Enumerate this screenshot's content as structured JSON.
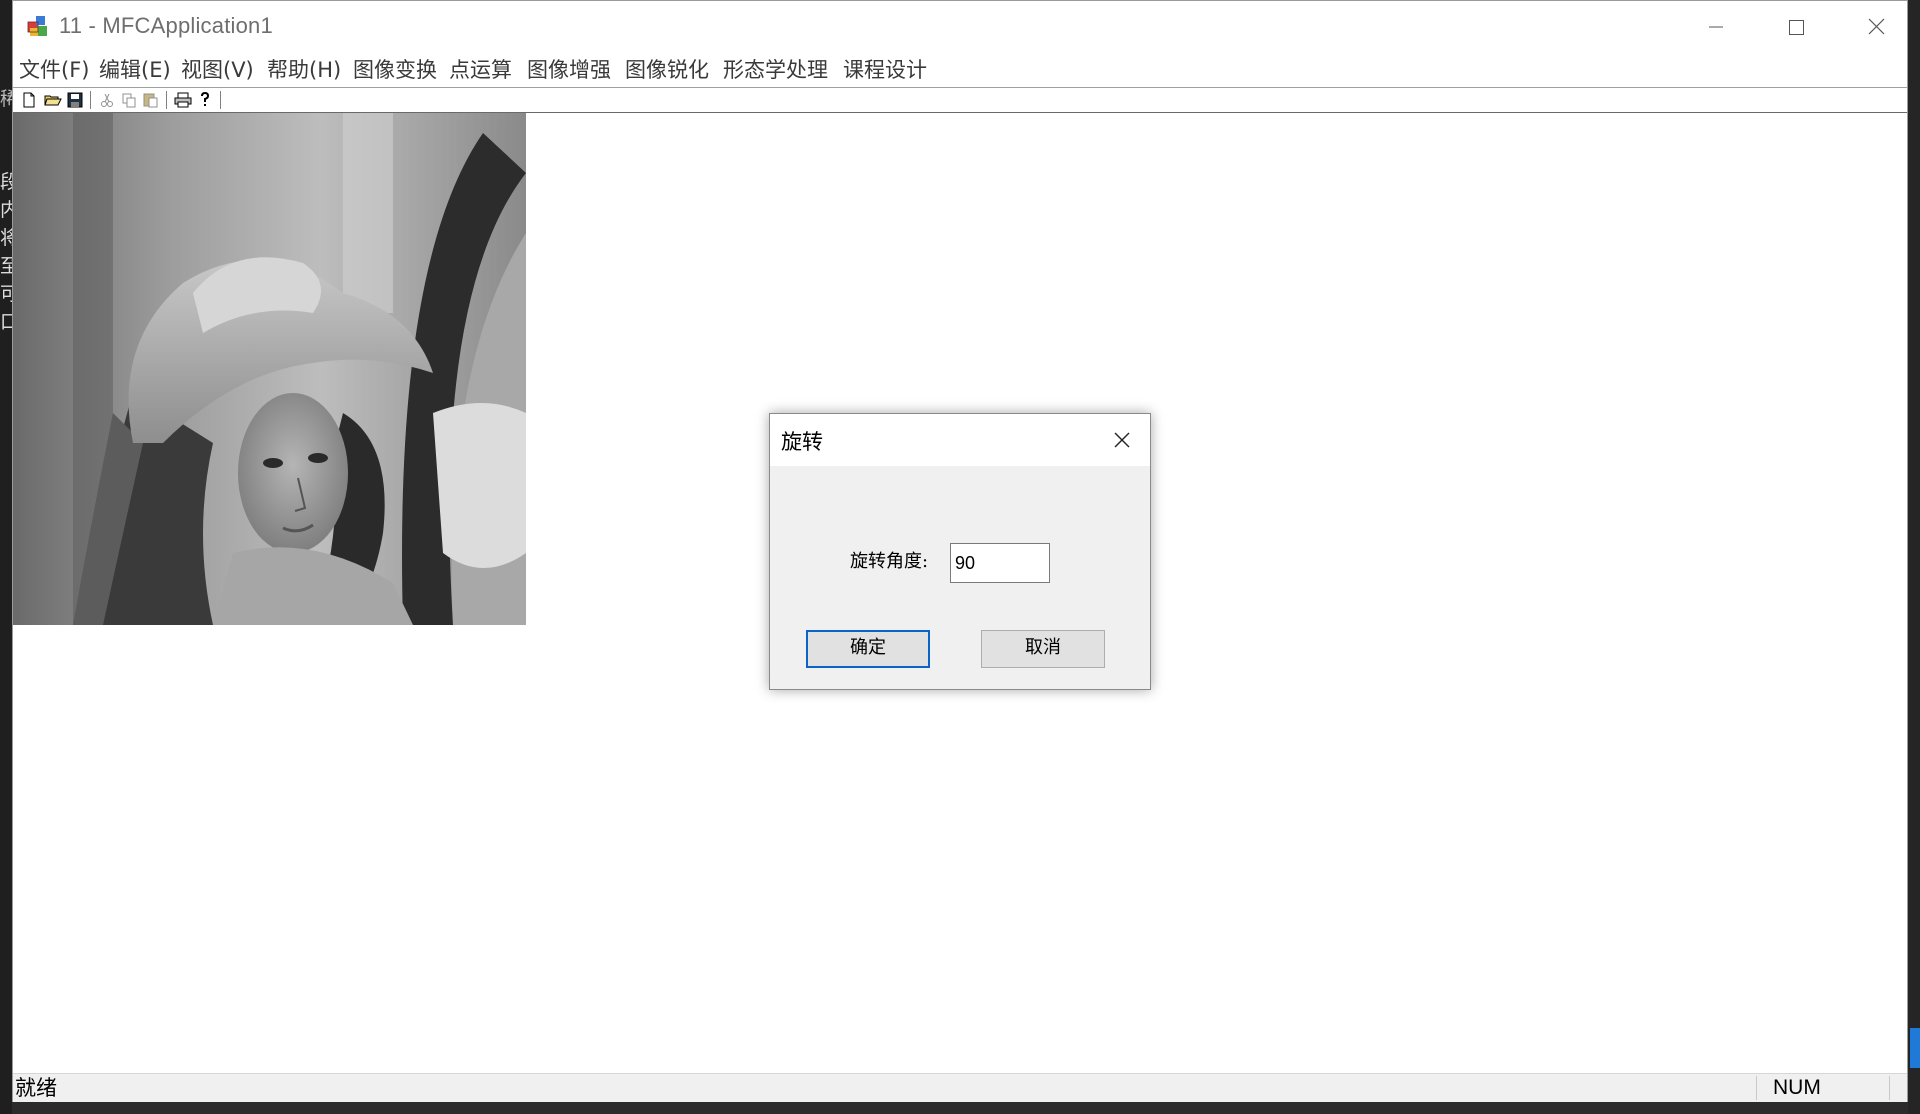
{
  "window": {
    "title": "11 - MFCApplication1"
  },
  "background": {
    "left_chars": [
      "稀",
      "段",
      "内",
      "将",
      "至",
      "可",
      "口"
    ]
  },
  "menu": [
    {
      "label": "文件(F)"
    },
    {
      "label": "编辑(E)"
    },
    {
      "label": "视图(V)"
    },
    {
      "label": "帮助(H)"
    },
    {
      "label": "图像变换"
    },
    {
      "label": "点运算"
    },
    {
      "label": "图像增强"
    },
    {
      "label": "图像锐化"
    },
    {
      "label": "形态学处理"
    },
    {
      "label": "课程设计"
    }
  ],
  "toolbar": {
    "icons": [
      "new-file-icon",
      "open-folder-icon",
      "save-icon",
      "cut-icon",
      "copy-icon",
      "paste-icon",
      "print-icon",
      "help-icon"
    ]
  },
  "dialog": {
    "title": "旋转",
    "angle_label": "旋转角度:",
    "angle_value": "90",
    "ok_label": "确定",
    "cancel_label": "取消"
  },
  "status": {
    "text": "就绪",
    "num": "NUM"
  },
  "colors": {
    "window_bg": "#ffffff",
    "dialog_bg": "#f0f0f0",
    "ok_border": "#0a64c8",
    "status_bg": "#f0f0f0"
  }
}
